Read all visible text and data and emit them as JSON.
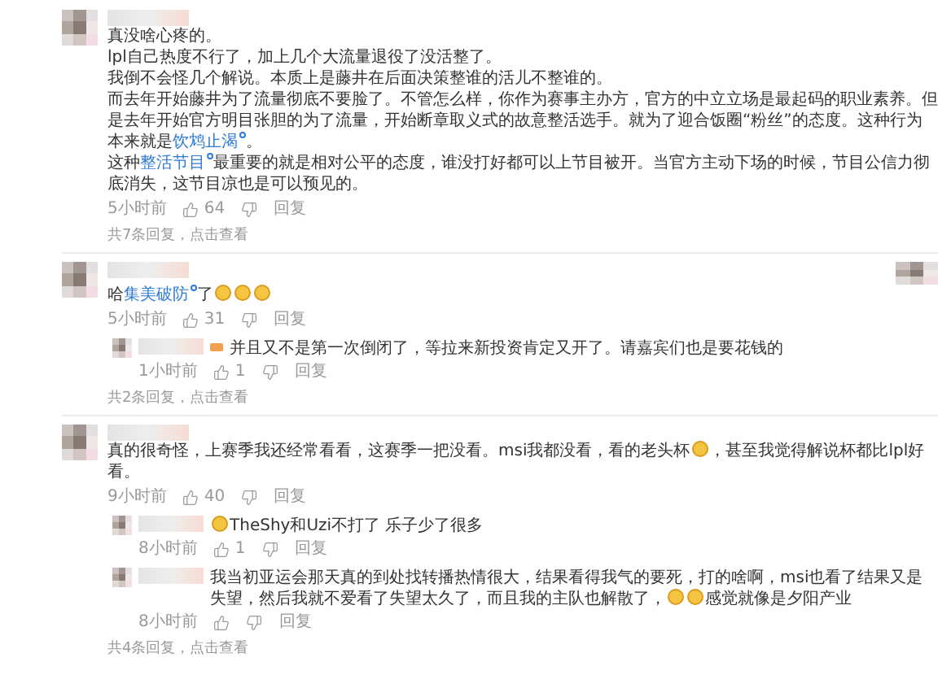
{
  "comments": [
    {
      "paragraphs": [
        [
          {
            "kind": "text",
            "text": "真没啥心疼的。"
          }
        ],
        [
          {
            "kind": "text",
            "text": "lpl自己热度不行了，加上几个大流量退役了没活整了。"
          }
        ],
        [
          {
            "kind": "text",
            "text": "我倒不会怪几个解说。本质上是藤井在后面决策整谁的活儿不整谁的。"
          }
        ],
        [
          {
            "kind": "text",
            "text": "而去年开始藤井为了流量彻底不要脸了。不管怎么样，你作为赛事主办方，官方的中立立场是最起码的职业素养。但是去年开始官方明目张胆的为了流量，开始断章取义式的故意整活选手。就为了迎合饭圈“粉丝”的态度。这种行为本来就是"
          },
          {
            "kind": "topic",
            "text": "饮鸩止渴"
          },
          {
            "kind": "text",
            "text": "。"
          }
        ],
        [
          {
            "kind": "text",
            "text": "这种"
          },
          {
            "kind": "topic",
            "text": "整活节目"
          },
          {
            "kind": "text",
            "text": "最重要的就是相对公平的态度，谁没打好都可以上节目被开。当官方主动下场的时候，节目公信力彻底消失，这节目凉也是可以预见的。"
          }
        ]
      ],
      "time": "5小时前",
      "likes": "64",
      "reply_label": "回复",
      "side_avatar": false,
      "more": "共7条回复，点击查看"
    },
    {
      "paragraphs": [
        [
          {
            "kind": "text",
            "text": "哈"
          },
          {
            "kind": "topic",
            "text": "集美破防"
          },
          {
            "kind": "text",
            "text": "了"
          },
          {
            "kind": "emoji"
          },
          {
            "kind": "emoji"
          },
          {
            "kind": "emoji"
          }
        ]
      ],
      "time": "5小时前",
      "likes": "31",
      "reply_label": "回复",
      "side_avatar": true,
      "replies": [
        {
          "badge": true,
          "segments": [
            {
              "kind": "text",
              "text": "并且又不是第一次倒闭了，等拉来新投资肯定又开了。请嘉宾们也是要花钱的"
            }
          ],
          "time": "1小时前",
          "likes": "1",
          "reply_label": "回复"
        }
      ],
      "more": "共2条回复，点击查看"
    },
    {
      "paragraphs": [
        [
          {
            "kind": "text",
            "text": "真的很奇怪，上赛季我还经常看看，这赛季一把没看。msi我都没看，看的老头杯"
          },
          {
            "kind": "emoji"
          },
          {
            "kind": "text",
            "text": "，甚至我觉得解说杯都比lpl好看。"
          }
        ]
      ],
      "time": "9小时前",
      "likes": "40",
      "reply_label": "回复",
      "side_avatar": false,
      "replies": [
        {
          "badge": false,
          "segments": [
            {
              "kind": "emoji"
            },
            {
              "kind": "text",
              "text": "TheShy和Uzi不打了 乐子少了很多"
            }
          ],
          "time": "8小时前",
          "likes": "1",
          "reply_label": "回复"
        },
        {
          "badge": false,
          "segments": [
            {
              "kind": "text",
              "text": "我当初亚运会那天真的到处找转播热情很大，结果看得我气的要死，打的啥啊，msi也看了结果又是失望，然后我就不爱看了失望太久了，而且我的主队也解散了，"
            },
            {
              "kind": "emoji"
            },
            {
              "kind": "emoji"
            },
            {
              "kind": "text",
              "text": "感觉就像是夕阳产业"
            }
          ],
          "time": "8小时前",
          "reply_label": "回复"
        }
      ],
      "more": "共4条回复，点击查看"
    }
  ]
}
